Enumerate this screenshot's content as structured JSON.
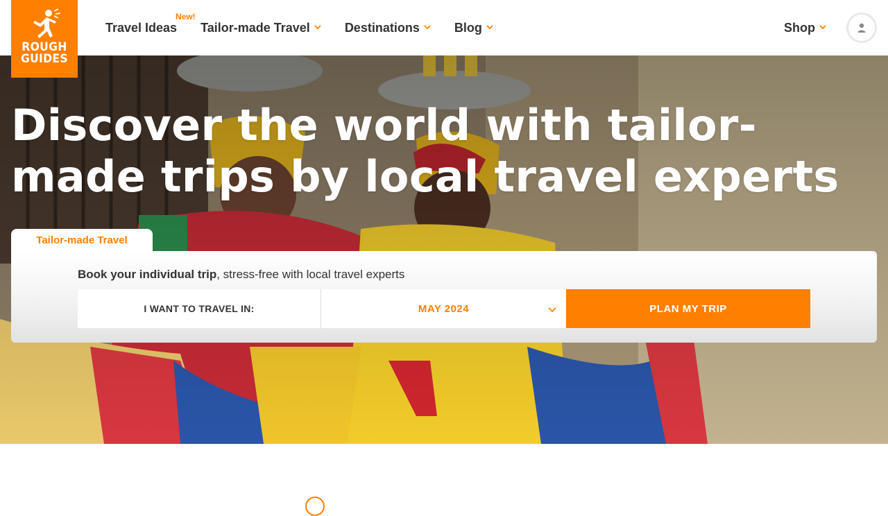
{
  "brand": {
    "logo_line1": "ROUGH",
    "logo_line2": "GUIDES",
    "accent_color": "#ff7f00"
  },
  "nav": {
    "items": [
      {
        "label": "Travel Ideas",
        "badge": "New!"
      },
      {
        "label": "Tailor-made Travel",
        "icon": "chevron-down-icon"
      },
      {
        "label": "Destinations",
        "icon": "chevron-down-icon"
      },
      {
        "label": "Blog",
        "icon": "chevron-down-icon"
      }
    ],
    "shop_label": "Shop",
    "account_icon": "user-icon"
  },
  "hero": {
    "title": "Discover the world with tailor-made trips by local travel experts"
  },
  "booking": {
    "tab_label": "Tailor-made Travel",
    "text_bold": "Book your individual trip",
    "text_rest": ", stress-free with local travel experts",
    "field_label": "I WANT TO TRAVEL IN:",
    "month_value": "MAY 2024",
    "cta_label": "PLAN MY TRIP"
  }
}
